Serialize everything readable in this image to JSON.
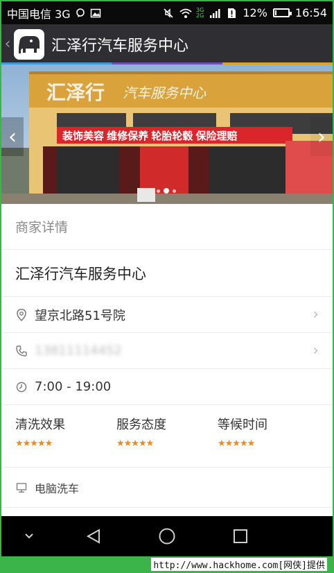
{
  "status_bar": {
    "carrier": "中国电信 3G",
    "network_3g": "3G",
    "network_2g": "2G",
    "battery_percent": "12%",
    "battery_level": 0.12,
    "time": "16:54"
  },
  "title_bar": {
    "title": "汇泽行汽车服务中心",
    "back_icon": "chevron-left-icon",
    "logo_icon": "elephant-logo-icon",
    "accent_colors": [
      "#3a9ad9",
      "#6b4fbb",
      "#e0a020"
    ]
  },
  "banner": {
    "sign_main": "汇泽行",
    "sign_sub": "汽车服务中心",
    "banner_text": "装饰美容 维修保养 轮胎轮毂 保险理赔",
    "prev_icon": "chevron-left-icon",
    "next_icon": "chevron-right-icon",
    "slide_count": 3,
    "active_slide": 2
  },
  "details": {
    "section_title": "商家详情",
    "shop_name": "汇泽行汽车服务中心",
    "address": "望京北路51号院",
    "phone": "13811114452",
    "hours": "7:00 - 19:00",
    "ratings": [
      {
        "label": "清洗效果",
        "stars": 5
      },
      {
        "label": "服务态度",
        "stars": 5
      },
      {
        "label": "等候时间",
        "stars": 5
      }
    ],
    "service": "电脑洗车"
  },
  "nav_bar": {
    "icons": [
      "chevron-down-icon",
      "back-triangle-icon",
      "home-circle-icon",
      "recents-square-icon"
    ]
  },
  "watermark": "http://www.hackhome.com[网侠]提供"
}
